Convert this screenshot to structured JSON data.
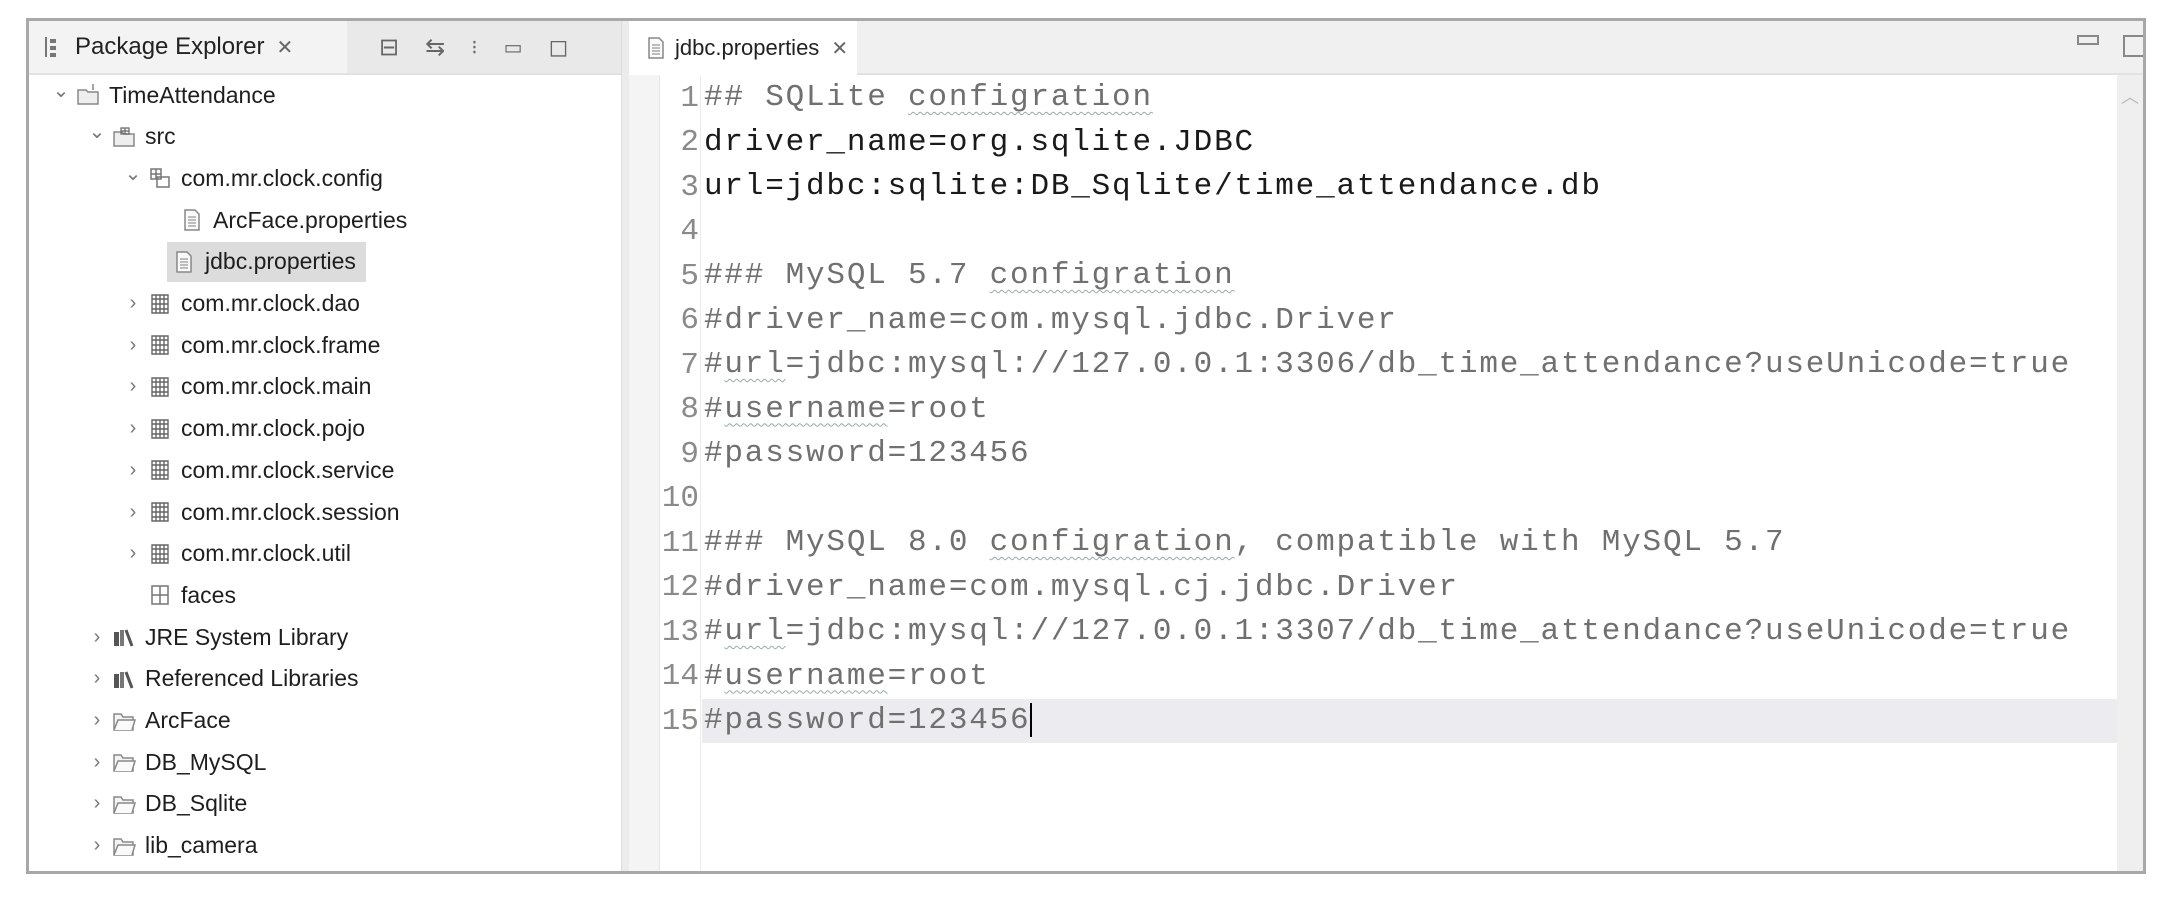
{
  "package_explorer": {
    "title": "Package Explorer",
    "close_glyph": "✕",
    "toolbar": [
      "collapse-all-icon",
      "link-with-editor-icon",
      "view-menu-icon",
      "minimize-icon",
      "maximize-icon"
    ],
    "tree": [
      {
        "label": "TimeAttendance",
        "level": 0,
        "chevron": "open",
        "icon": "project"
      },
      {
        "label": "src",
        "level": 1,
        "chevron": "open",
        "icon": "source-folder"
      },
      {
        "label": "com.mr.clock.config",
        "level": 2,
        "chevron": "open",
        "icon": "package-open"
      },
      {
        "label": "ArcFace.properties",
        "level": 3,
        "chevron": "none",
        "icon": "file"
      },
      {
        "label": "jdbc.properties",
        "level": 3,
        "chevron": "none",
        "icon": "file",
        "selected": true
      },
      {
        "label": "com.mr.clock.dao",
        "level": 2,
        "chevron": "closed",
        "icon": "package"
      },
      {
        "label": "com.mr.clock.frame",
        "level": 2,
        "chevron": "closed",
        "icon": "package"
      },
      {
        "label": "com.mr.clock.main",
        "level": 2,
        "chevron": "closed",
        "icon": "package"
      },
      {
        "label": "com.mr.clock.pojo",
        "level": 2,
        "chevron": "closed",
        "icon": "package"
      },
      {
        "label": "com.mr.clock.service",
        "level": 2,
        "chevron": "closed",
        "icon": "package"
      },
      {
        "label": "com.mr.clock.session",
        "level": 2,
        "chevron": "closed",
        "icon": "package"
      },
      {
        "label": "com.mr.clock.util",
        "level": 2,
        "chevron": "closed",
        "icon": "package"
      },
      {
        "label": "faces",
        "level": 2,
        "chevron": "none",
        "icon": "package-empty"
      },
      {
        "label": "JRE System Library",
        "level": 1,
        "chevron": "closed",
        "icon": "library"
      },
      {
        "label": "Referenced Libraries",
        "level": 1,
        "chevron": "closed",
        "icon": "library"
      },
      {
        "label": "ArcFace",
        "level": 1,
        "chevron": "closed",
        "icon": "folder"
      },
      {
        "label": "DB_MySQL",
        "level": 1,
        "chevron": "closed",
        "icon": "folder"
      },
      {
        "label": "DB_Sqlite",
        "level": 1,
        "chevron": "closed",
        "icon": "folder"
      },
      {
        "label": "lib_camera",
        "level": 1,
        "chevron": "closed",
        "icon": "folder"
      }
    ]
  },
  "editor": {
    "tab_label": "jdbc.properties",
    "close_glyph": "✕",
    "current_line": 15,
    "lines": [
      {
        "num": "1",
        "tone": "grey",
        "segs": [
          {
            "t": "## SQLite "
          },
          {
            "t": "configration",
            "sq": true
          }
        ]
      },
      {
        "num": "2",
        "tone": "black",
        "segs": [
          {
            "t": "driver_name=org.sqlite.JDBC"
          }
        ]
      },
      {
        "num": "3",
        "tone": "black",
        "segs": [
          {
            "t": "url=jdbc:sqlite:DB_Sqlite/time_attendance.db"
          }
        ]
      },
      {
        "num": "4",
        "tone": "grey",
        "segs": []
      },
      {
        "num": "5",
        "tone": "grey",
        "segs": [
          {
            "t": "### MySQL 5.7 "
          },
          {
            "t": "configration",
            "sq": true
          }
        ]
      },
      {
        "num": "6",
        "tone": "grey",
        "segs": [
          {
            "t": "#driver_name=com.mysql.jdbc.Driver"
          }
        ]
      },
      {
        "num": "7",
        "tone": "grey",
        "segs": [
          {
            "t": "#"
          },
          {
            "t": "url",
            "sq": true
          },
          {
            "t": "=jdbc:mysql://127.0.0.1:3306/db_time_attendance?useUnicode=true"
          }
        ]
      },
      {
        "num": "8",
        "tone": "grey",
        "segs": [
          {
            "t": "#"
          },
          {
            "t": "username",
            "sq": true
          },
          {
            "t": "=root"
          }
        ]
      },
      {
        "num": "9",
        "tone": "grey",
        "segs": [
          {
            "t": "#password=123456"
          }
        ]
      },
      {
        "num": "10",
        "tone": "grey",
        "segs": []
      },
      {
        "num": "11",
        "tone": "grey",
        "segs": [
          {
            "t": "### MySQL 8.0 "
          },
          {
            "t": "configration",
            "sq": true
          },
          {
            "t": ", compatible with MySQL 5.7"
          }
        ]
      },
      {
        "num": "12",
        "tone": "grey",
        "segs": [
          {
            "t": "#driver_name=com.mysql.cj.jdbc.Driver"
          }
        ]
      },
      {
        "num": "13",
        "tone": "grey",
        "segs": [
          {
            "t": "#"
          },
          {
            "t": "url",
            "sq": true
          },
          {
            "t": "=jdbc:mysql://127.0.0.1:3307/db_time_attendance?useUnicode=true"
          }
        ]
      },
      {
        "num": "14",
        "tone": "grey",
        "segs": [
          {
            "t": "#"
          },
          {
            "t": "username",
            "sq": true
          },
          {
            "t": "=root"
          }
        ]
      },
      {
        "num": "15",
        "tone": "grey",
        "segs": [
          {
            "t": "#password=123456"
          }
        ]
      }
    ]
  }
}
